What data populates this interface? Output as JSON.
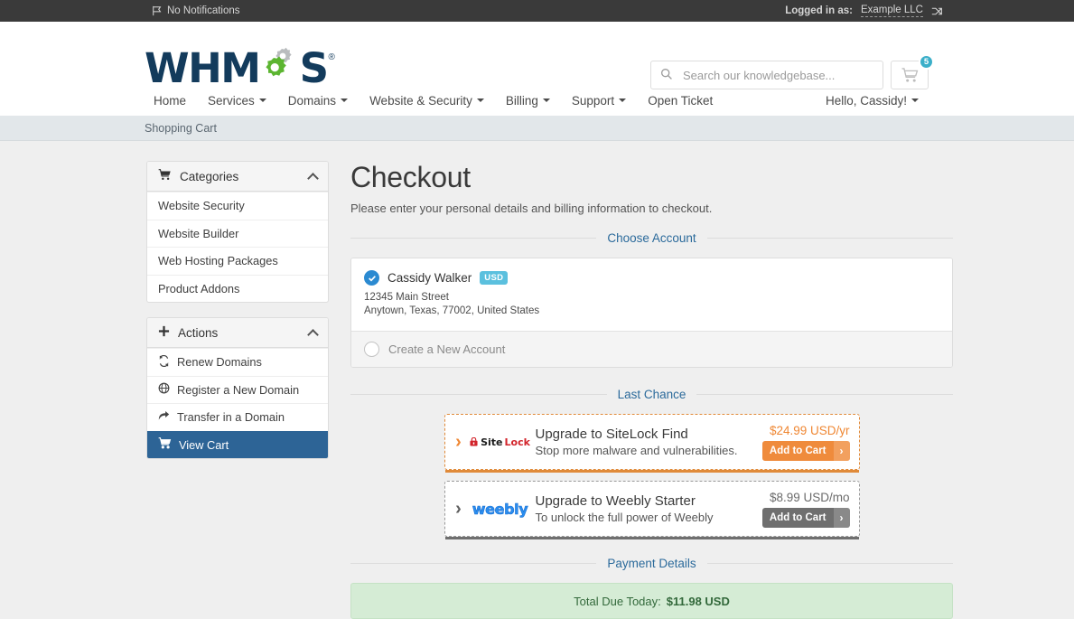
{
  "topbar": {
    "notifications": "No Notifications",
    "logged_in_label": "Logged in as:",
    "company": "Example LLC"
  },
  "header": {
    "logo_text": "WHM",
    "logo_text_end": "S",
    "logo_reg": "®",
    "search_placeholder": "Search our knowledgebase...",
    "search_value": "",
    "cart_count": "5"
  },
  "nav": {
    "items": [
      {
        "label": "Home",
        "caret": false
      },
      {
        "label": "Services",
        "caret": true
      },
      {
        "label": "Domains",
        "caret": true
      },
      {
        "label": "Website & Security",
        "caret": true
      },
      {
        "label": "Billing",
        "caret": true
      },
      {
        "label": "Support",
        "caret": true
      },
      {
        "label": "Open Ticket",
        "caret": false
      }
    ],
    "user_menu": "Hello, Cassidy!"
  },
  "breadcrumb": {
    "text": "Shopping Cart"
  },
  "sidebar": {
    "categories": {
      "title": "Categories",
      "icon": "cart-icon",
      "items": [
        {
          "label": "Website Security"
        },
        {
          "label": "Website Builder"
        },
        {
          "label": "Web Hosting Packages"
        },
        {
          "label": "Product Addons"
        }
      ]
    },
    "actions": {
      "title": "Actions",
      "icon": "plus-icon",
      "items": [
        {
          "label": "Renew Domains",
          "icon": "refresh-icon",
          "active": false
        },
        {
          "label": "Register a New Domain",
          "icon": "globe-icon",
          "active": false
        },
        {
          "label": "Transfer in a Domain",
          "icon": "transfer-icon",
          "active": false
        },
        {
          "label": "View Cart",
          "icon": "cart-icon",
          "active": true
        }
      ]
    }
  },
  "main": {
    "title": "Checkout",
    "subtitle": "Please enter your personal details and billing information to checkout.",
    "choose_account_legend": "Choose Account",
    "account": {
      "name": "Cassidy Walker",
      "currency_badge": "USD",
      "address_line1": "12345 Main Street",
      "address_line2": "Anytown, Texas, 77002, United States",
      "create_new_label": "Create a New Account"
    },
    "last_chance_legend": "Last Chance",
    "upsells": [
      {
        "logo": "sitelock-logo",
        "logo_part1": "Site",
        "logo_part2": "Lock",
        "title": "Upgrade to SiteLock Find",
        "description": "Stop more malware and vulnerabilities.",
        "price": "$24.99 USD/yr",
        "button_label": "Add to Cart",
        "style": "orange"
      },
      {
        "logo": "weebly-logo",
        "logo_part1": "weebly",
        "logo_part2": "",
        "title": "Upgrade to Weebly Starter",
        "description": "To unlock the full power of Weebly",
        "price": "$8.99 USD/mo",
        "button_label": "Add to Cart",
        "style": "gray"
      }
    ],
    "payment_details_legend": "Payment Details",
    "total": {
      "label": "Total Due Today:",
      "amount": "$11.98 USD"
    }
  },
  "colors": {
    "brand_navy": "#133b5c",
    "brand_green": "#5cb531",
    "accent_blue": "#2b6a9b",
    "active_blue": "#2d6496",
    "orange": "#ef8b3c",
    "badge_teal": "#3bafc9",
    "success_green": "#d5ecd5"
  }
}
